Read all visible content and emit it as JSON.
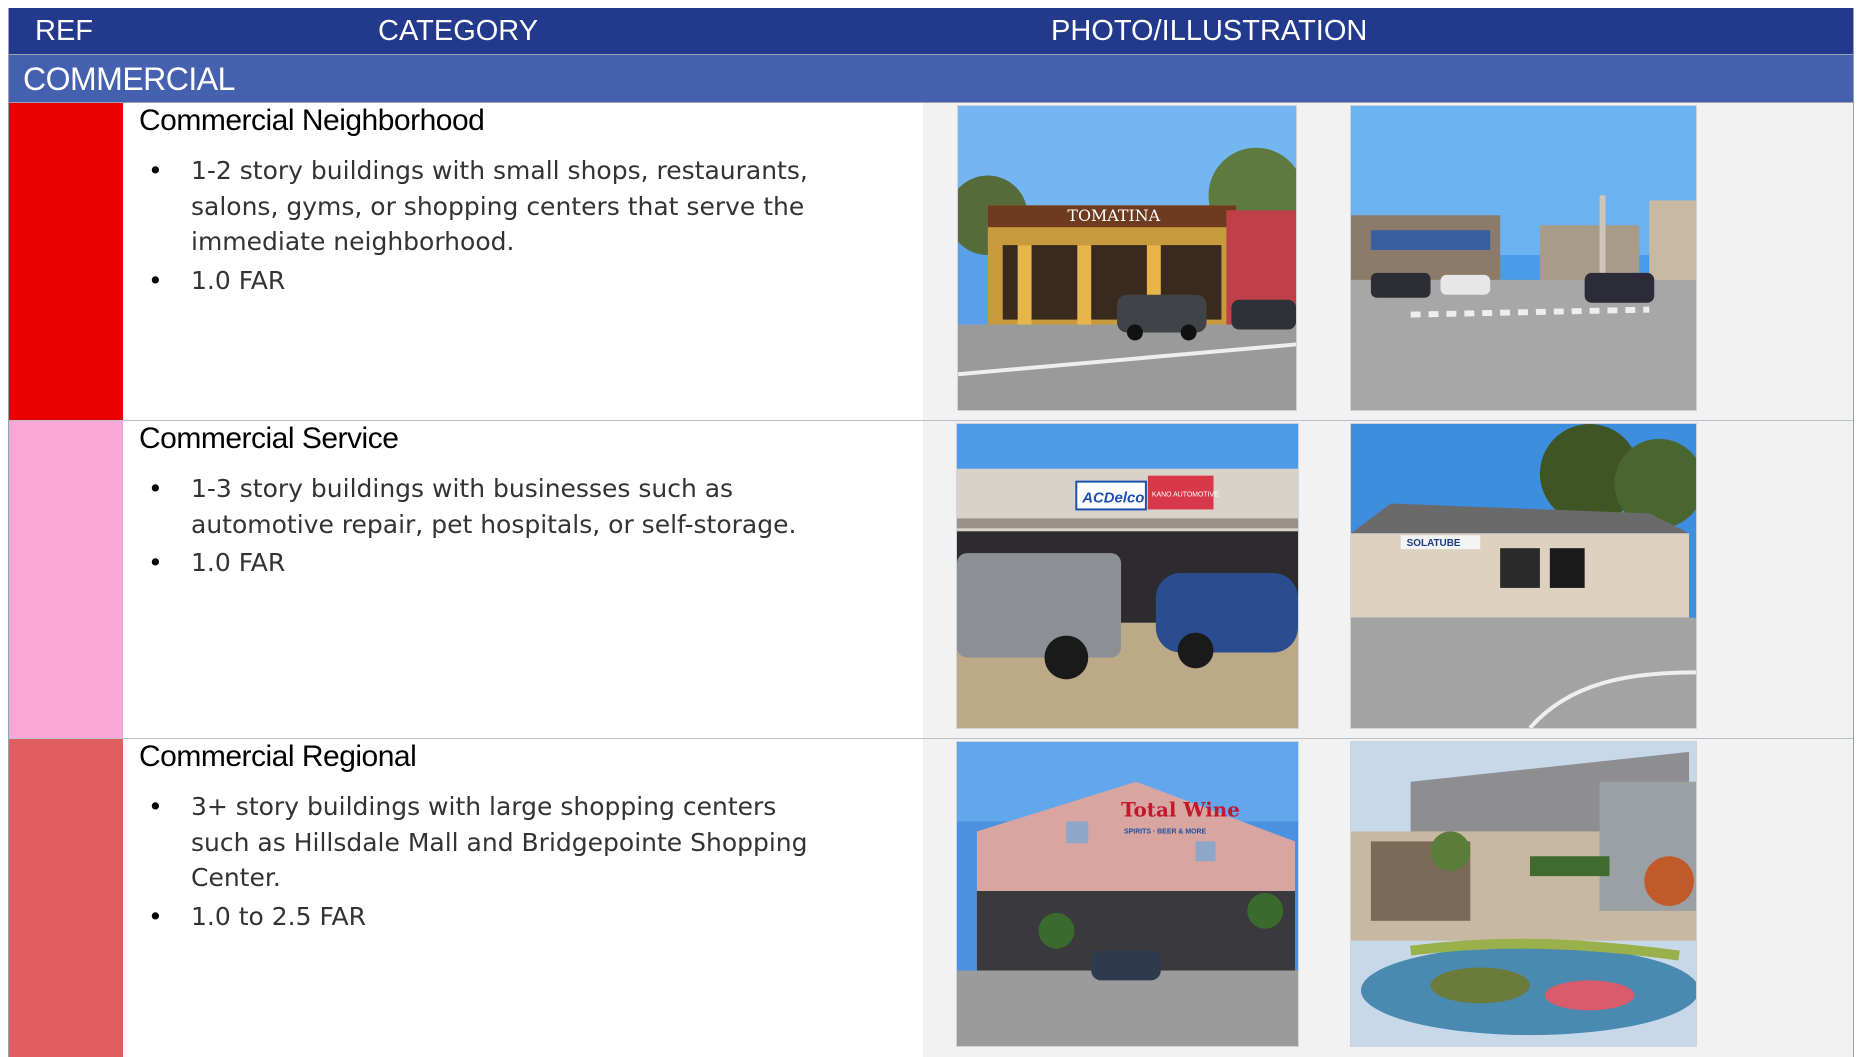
{
  "header": {
    "ref": "REF",
    "category": "CATEGORY",
    "photo": "PHOTO/ILLUSTRATION"
  },
  "section": {
    "label": "COMMERCIAL"
  },
  "rows": [
    {
      "color": "#e90000",
      "title": "Commercial Neighborhood",
      "bullets": [
        "1-2 story buildings with small shops, restaurants, salons, gyms, or shopping centers that serve the immediate neighborhood.",
        "1.0 FAR"
      ],
      "photos": [
        {
          "name": "photo-tomatina-storefront",
          "sign": "TOMATINA"
        },
        {
          "name": "photo-neighborhood-street"
        }
      ]
    },
    {
      "color": "#f9a8d8",
      "title": "Commercial Service",
      "bullets": [
        "1-3 story buildings with businesses such as automotive repair, pet hospitals, or self-storage.",
        "1.0 FAR"
      ],
      "photos": [
        {
          "name": "photo-auto-repair-shop",
          "sign": "ACDelco",
          "sign2": "KANO AUTOMOTIVE"
        },
        {
          "name": "photo-solatube-building",
          "sign": "SOLATUBE"
        }
      ]
    },
    {
      "color": "#e05e60",
      "title": "Commercial Regional",
      "bullets": [
        "3+ story buildings with large shopping centers such as Hillsdale Mall and Bridgepointe Shopping Center.",
        "1.0 to 2.5 FAR"
      ],
      "photos": [
        {
          "name": "photo-total-wine-store",
          "sign": "Total Wine",
          "sign2": "SPIRITS · BEER & MORE"
        },
        {
          "name": "photo-mall-plaza-rendering"
        }
      ]
    }
  ]
}
